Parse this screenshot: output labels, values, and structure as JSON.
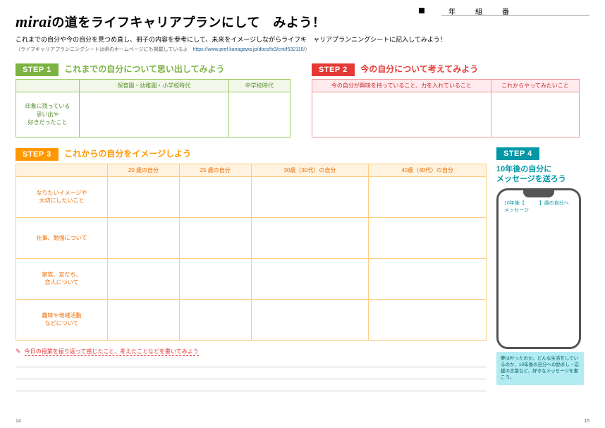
{
  "header": {
    "grade_labels": [
      "年",
      "組",
      "番"
    ],
    "title_prefix": "mirai",
    "title_rest": "の道をライフキャリアプランにして　みよう！",
    "subtitle": "これまでの自分や今の自分を見つめ直し、冊子の内容を参考にして、未来をイメージしながらライフキ　ャリアプランニングシートに記入してみよう！",
    "subnote_prefix": "（ライフキャリアプランニングシートは県のホームページにも掲載しているよ　",
    "subnote_url": "https://www.pref.kanagawa.jp/docs/fz3/cnt/f532110/",
    "subnote_suffix": "）"
  },
  "step1": {
    "badge": "STEP 1",
    "title": "これまでの自分について思い出してみよう",
    "col1": "保育園・幼稚園・小学校時代",
    "col2": "中学校時代",
    "row1": "印象に残っている\n思い出や\n好きだったこと"
  },
  "step2": {
    "badge": "STEP 2",
    "title": "今の自分について考えてみよう",
    "col1": "今の自分が興味を持っていること、力を入れていること",
    "col2": "これからやってみたいこと"
  },
  "step3": {
    "badge": "STEP 3",
    "title": "これからの自分をイメージしよう",
    "cols": [
      "20 歳の自分",
      "25 歳の自分",
      "30歳（30代）の自分",
      "40歳（40代）の自分"
    ],
    "rows": [
      "なりたいイメージや\n大切にしたいこと",
      "仕事、勉強について",
      "家族、友だち、\n恋人について",
      "趣味や地域活動\nなどについて"
    ]
  },
  "step4": {
    "badge": "STEP 4",
    "title": "10年後の自分に\nメッセージを送ろう",
    "phone_msg": "10年後【　　　】歳の自分へ\nメッセージ",
    "note": "夢は叶ったのか、どんな生活をしているのか、10年後の自分への励まし・応援の言葉など、好きなメッセージを書こう。"
  },
  "reflection": {
    "prompt": "今日の授業を振り返って感じたこと、考えたことなどを書いてみよう"
  },
  "page_left": "14",
  "page_right": "15"
}
